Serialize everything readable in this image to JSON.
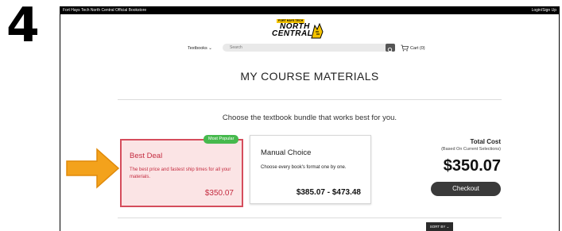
{
  "step": {
    "number": "4"
  },
  "topbar": {
    "store_name": "Fort Hays Tech North Central Official Bookstore",
    "login_label": "Login/Sign Up"
  },
  "logo": {
    "badge": "FORT HAYS TECH",
    "line1": "NORTH",
    "line2": "CENTRAL"
  },
  "nav": {
    "textbooks_label": "Textbooks ⌄",
    "search_placeholder": "Search",
    "cart_label": "Cart (0)"
  },
  "page": {
    "title": "MY COURSE MATERIALS",
    "subtitle": "Choose the textbook bundle that works best for you."
  },
  "bundles": {
    "best": {
      "badge": "Most Popular",
      "title": "Best Deal",
      "description": "The best price and fastest ship times for all your materials.",
      "price": "$350.07"
    },
    "manual": {
      "title": "Manual Choice",
      "description": "Choose every book's format one by one.",
      "price": "$385.07 - $473.48"
    }
  },
  "total": {
    "label": "Total Cost",
    "sublabel": "(Based On Current Selections)",
    "value": "$350.07",
    "checkout_label": "Checkout"
  },
  "sort": {
    "label": "SORT BY ⌄"
  },
  "colors": {
    "accent_red": "#c42c40",
    "popular_green": "#46b94d",
    "arrow_orange": "#f3a21c"
  }
}
